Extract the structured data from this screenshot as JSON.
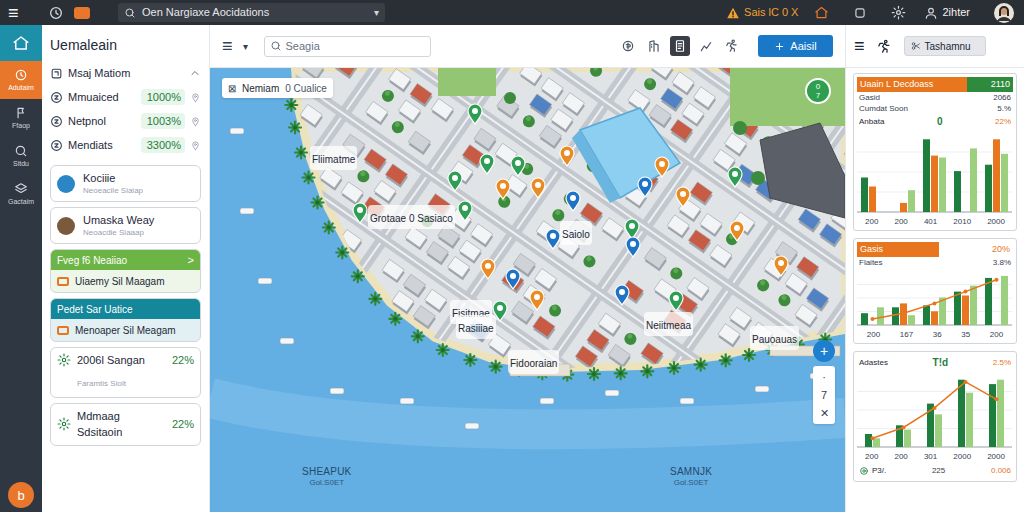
{
  "topbar": {
    "menu": "≡",
    "search": {
      "value": "Oen Nargiaxe Aocidations",
      "chevron": "▾"
    },
    "alert": "Sais lC 0 X",
    "user": "2ihter"
  },
  "rail": {
    "items": [
      {
        "label": "Adutaim",
        "selected": true
      },
      {
        "label": "Ffaop",
        "selected": false
      },
      {
        "label": "Sitdu",
        "selected": false
      },
      {
        "label": "Gactaim",
        "selected": false
      }
    ],
    "fab": "b"
  },
  "panel": {
    "title": "Uemaleain",
    "section": {
      "title": "Msaj Matiom",
      "expanded": true
    },
    "metrics": [
      {
        "label": "Mmuaiced",
        "value": "1000%"
      },
      {
        "label": "Netpnol",
        "value": "1003%"
      },
      {
        "label": "Mendiats",
        "value": "3300%"
      }
    ],
    "cards": [
      {
        "kind": "plain",
        "title": "Kociiie",
        "subtitle": "Neoeacile Siaiap",
        "color": "#2b86c5"
      },
      {
        "kind": "plain",
        "title": "Umaska Weay",
        "subtitle": "Neoacdie Siaaap",
        "color": "#7a5a3c"
      },
      {
        "kind": "header",
        "header": "Fveg f6 Neaiiao",
        "arrow": ">",
        "body": "Uiaemy Sil Maagam",
        "color": "#6db446"
      },
      {
        "kind": "header",
        "header": "Pedet Sar Uatice",
        "body": "Menoaper Sil Meagam",
        "color": "#15879b"
      },
      {
        "kind": "stat",
        "title": "2006l Sangan",
        "value": "22%",
        "subtitle": "Faramtis Siolt"
      },
      {
        "kind": "stat",
        "title": "Mdmaag Sdsitaoin",
        "value": "22%"
      }
    ]
  },
  "map": {
    "toolbar": {
      "menu": "≡",
      "chevron": "▾",
      "search": {
        "placeholder": "Seagia"
      },
      "tools": [
        {
          "selected": false
        },
        {
          "selected": false
        },
        {
          "selected": true
        },
        {
          "selected": false
        },
        {
          "selected": false
        }
      ],
      "button": "Aaisil"
    },
    "chip": {
      "icon": "⊠",
      "text": "Nemiam",
      "extra": "0 Cualice"
    },
    "badge": [
      "0",
      "7"
    ],
    "labels": [
      {
        "text": "Fliimatme",
        "kind": "place"
      },
      {
        "text": "Grotaae 0 Sasiaco",
        "kind": "place"
      },
      {
        "text": "Saiolo",
        "kind": "place"
      },
      {
        "text": "Fisitmae",
        "kind": "place"
      },
      {
        "text": "Rasiiiae",
        "kind": "place"
      },
      {
        "text": "Fidooraian",
        "kind": "place"
      },
      {
        "text": "Neiitmeaa",
        "kind": "place"
      },
      {
        "text": "Pauoauas",
        "kind": "place"
      },
      {
        "text": "SHEAPUK",
        "sub": "Gol.S0ET",
        "kind": "water"
      },
      {
        "text": "SAMNJK",
        "sub": "Gol.S0ET",
        "kind": "water"
      }
    ],
    "pins": [
      {
        "color": "#2f9e55"
      },
      {
        "color": "#2f9e55"
      },
      {
        "color": "#2f9e55"
      },
      {
        "color": "#2f9e55"
      },
      {
        "color": "#2f9e55"
      },
      {
        "color": "#2f9e55"
      },
      {
        "color": "#2f9e55"
      },
      {
        "color": "#2f9e55"
      },
      {
        "color": "#2f9e55"
      },
      {
        "color": "#2f9e55"
      },
      {
        "color": "#ea8a22"
      },
      {
        "color": "#ea8a22"
      },
      {
        "color": "#ea8a22"
      },
      {
        "color": "#ea8a22"
      },
      {
        "color": "#ea8a22"
      },
      {
        "color": "#ea8a22"
      },
      {
        "color": "#ea8a22"
      },
      {
        "color": "#ea8a22"
      },
      {
        "color": "#ea8a22"
      },
      {
        "color": "#1f73c4"
      },
      {
        "color": "#1f73c4"
      },
      {
        "color": "#1f73c4"
      },
      {
        "color": "#1f73c4"
      },
      {
        "color": "#1f73c4"
      },
      {
        "color": "#1f73c4"
      }
    ],
    "zoom": [
      "+",
      "·",
      "7",
      "✕"
    ]
  },
  "right": {
    "menu": "≡",
    "dropdown": "Tashamnu",
    "cards": [
      {
        "kind": "split",
        "header": "Uaain L Decdoass",
        "header_value": "2110",
        "lines": [
          {
            "label": "Gasid",
            "value": "2066"
          },
          {
            "label": "Cumdat Soon",
            "value": "5.%"
          }
        ],
        "summary": {
          "label": "Anbata",
          "mid": "0",
          "value": "22%"
        },
        "series": [
          {
            "kind": "bar",
            "color": "#1e7e3e",
            "values": [
              38,
              0,
              80,
              45,
              52
            ]
          },
          {
            "kind": "bar",
            "color": "#e8761f",
            "values": [
              28,
              10,
              62,
              0,
              80
            ]
          },
          {
            "kind": "bar",
            "color": "#9ccf7e",
            "values": [
              0,
              24,
              60,
              70,
              64
            ]
          }
        ],
        "ticks": [
          "200",
          "200",
          "401",
          "2010",
          "2000"
        ]
      },
      {
        "kind": "bar",
        "header": "Gasis",
        "header_value": "20%",
        "lines": [
          {
            "label": "Flaites",
            "value": "3.8%"
          }
        ],
        "series": [
          {
            "kind": "bar",
            "color": "#1e7e3e",
            "values": [
              12,
              18,
              20,
              34,
              48
            ]
          },
          {
            "kind": "bar",
            "color": "#e8761f",
            "values": [
              0,
              22,
              14,
              30,
              0
            ]
          },
          {
            "kind": "bar",
            "color": "#9ccf7e",
            "values": [
              18,
              10,
              28,
              40,
              50
            ]
          },
          {
            "kind": "line",
            "color": "#e8761f",
            "values": [
              6,
              12,
              22,
              34,
              46
            ]
          }
        ],
        "ticks": [
          "200",
          "167",
          "36",
          "35",
          "200"
        ]
      },
      {
        "kind": "plain",
        "summary": {
          "label": "Adastes",
          "mid": "T!d",
          "value": "2.5%"
        },
        "series": [
          {
            "kind": "bar",
            "color": "#1e7e3e",
            "values": [
              12,
              20,
              40,
              62,
              58
            ]
          },
          {
            "kind": "bar",
            "color": "#9ccf7e",
            "values": [
              8,
              16,
              30,
              50,
              62
            ]
          },
          {
            "kind": "line",
            "color": "#e8761f",
            "values": [
              8,
              18,
              36,
              60,
              44
            ]
          }
        ],
        "ticks": [
          "200",
          "200",
          "301",
          "2000",
          "2000"
        ],
        "footer": {
          "label": "P3/.",
          "mid": "225",
          "value": "0.006"
        }
      }
    ]
  }
}
